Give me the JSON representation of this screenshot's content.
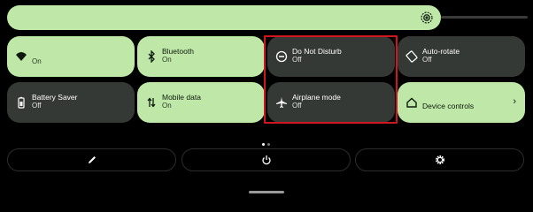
{
  "brightness": {
    "level": 0.83,
    "icon": "brightness-icon"
  },
  "tiles": [
    {
      "label": "",
      "state": "On",
      "icon": "wifi-icon",
      "active": true
    },
    {
      "label": "Bluetooth",
      "state": "On",
      "icon": "bluetooth-icon",
      "active": true
    },
    {
      "label": "Do Not Disturb",
      "state": "Off",
      "icon": "do-not-disturb-icon",
      "active": false
    },
    {
      "label": "Auto-rotate",
      "state": "Off",
      "icon": "auto-rotate-icon",
      "active": false
    },
    {
      "label": "Battery Saver",
      "state": "Off",
      "icon": "battery-saver-icon",
      "active": false
    },
    {
      "label": "Mobile data",
      "state": "On",
      "icon": "mobile-data-icon",
      "active": true
    },
    {
      "label": "Airplane mode",
      "state": "Off",
      "icon": "airplane-icon",
      "active": false
    },
    {
      "label": "Device controls",
      "state": "",
      "icon": "home-icon",
      "active": true
    }
  ],
  "page_indicator": {
    "pages": 2,
    "current": 1
  },
  "footer": {
    "edit_icon": "edit-icon",
    "power_icon": "power-icon",
    "settings_icon": "settings-icon"
  },
  "colors": {
    "tile_on": "#bfe8a8",
    "tile_off": "#353935",
    "highlight": "#d0161e"
  }
}
